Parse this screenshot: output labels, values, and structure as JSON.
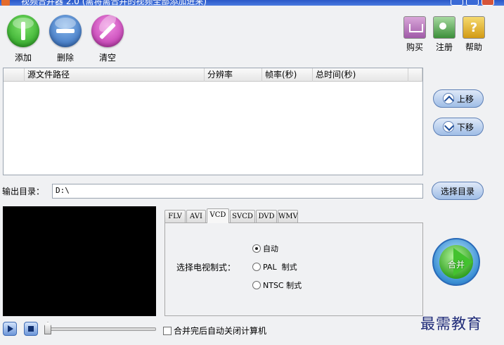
{
  "window": {
    "title": "视频合并器 2.0 (需将需合并的视频全部添加进来)"
  },
  "toolbar": {
    "add_label": "添加",
    "delete_label": "删除",
    "clear_label": "清空",
    "buy_label": "购买",
    "register_label": "注册",
    "help_label": "帮助"
  },
  "filelist": {
    "columns": [
      "源文件路径",
      "分辨率",
      "帧率(秒)",
      "总时间(秒)"
    ],
    "rows": []
  },
  "order": {
    "up_label": "上移",
    "down_label": "下移"
  },
  "output": {
    "label": "输出目录：",
    "value": "D:\\",
    "choose_label": "选择目录"
  },
  "tabs": {
    "items": [
      "FLV",
      "AVI",
      "VCD",
      "SVCD",
      "DVD",
      "WMV"
    ],
    "active": "VCD"
  },
  "vcd": {
    "tv_label": "选择电视制式：",
    "options": [
      "自动",
      "PAL  制式",
      "NTSC 制式"
    ],
    "selected": "自动"
  },
  "merge": {
    "label": "合并"
  },
  "shutdown": {
    "label": "合并完后自动关闭计算机",
    "checked": false
  },
  "watermark": {
    "text": "最需教育"
  },
  "colors": {
    "accent": "#5d7fb5",
    "merge_green": "#2f9f1e",
    "preview_bg": "#000000"
  }
}
